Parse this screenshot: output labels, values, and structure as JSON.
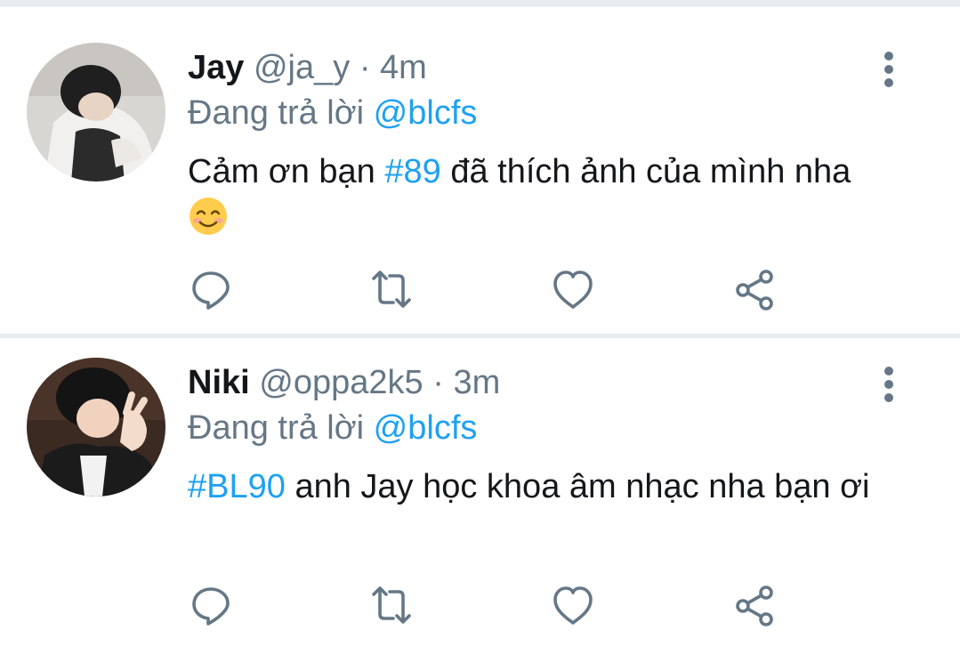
{
  "tweets": [
    {
      "name": "Jay",
      "handle": "@ja_y",
      "dot": "·",
      "time": "4m",
      "reply_prefix": "Đang trả lời ",
      "reply_mention": "@blcfs",
      "text_before": "Cảm ơn bạn ",
      "hashtag": "#89",
      "text_after": " đã thích ảnh của mình nha ",
      "emoji": "smiling-face-emoji"
    },
    {
      "name": "Niki",
      "handle": "@oppa2k5",
      "dot": "·",
      "time": "3m",
      "reply_prefix": "Đang trả lời ",
      "reply_mention": "@blcfs",
      "text_before": "",
      "hashtag": "#BL90",
      "text_after": " anh Jay học khoa âm nhạc nha bạn ơi"
    }
  ],
  "icons": {
    "reply": "reply-icon",
    "retweet": "retweet-icon",
    "like": "heart-icon",
    "share": "share-icon",
    "more": "more-vertical-icon"
  },
  "colors": {
    "link": "#1da1f2",
    "secondary": "#657786",
    "divider": "#e6ecf0"
  }
}
